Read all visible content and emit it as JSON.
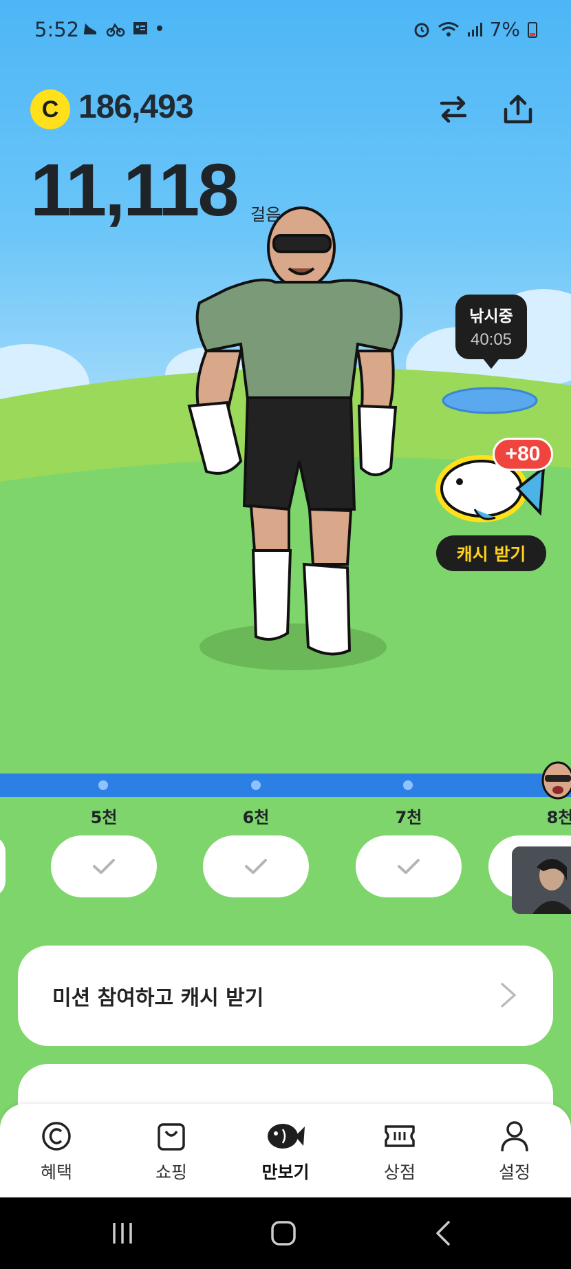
{
  "status_bar": {
    "time": "5:52",
    "battery": "7%"
  },
  "header": {
    "coin_symbol": "C",
    "coin_amount": "186,493"
  },
  "steps": {
    "count": "11,118",
    "unit": "걸음"
  },
  "fishing": {
    "label": "낚시중",
    "timer": "40:05",
    "bonus": "+80",
    "cash_button": "캐시 받기"
  },
  "milestones": [
    {
      "label": "5천",
      "completed": true
    },
    {
      "label": "6천",
      "completed": true
    },
    {
      "label": "7천",
      "completed": true
    },
    {
      "label": "8천",
      "completed": false
    }
  ],
  "mission": {
    "label": "미션 참여하고 캐시 받기"
  },
  "bottom_nav": {
    "items": [
      {
        "label": "혜택",
        "icon": "copyright-circle-icon"
      },
      {
        "label": "쇼핑",
        "icon": "shopping-bag-icon"
      },
      {
        "label": "만보기",
        "icon": "fish-icon",
        "active": true
      },
      {
        "label": "상점",
        "icon": "ticket-icon"
      },
      {
        "label": "설정",
        "icon": "person-icon"
      }
    ]
  },
  "colors": {
    "sky": "#4db6f6",
    "grass": "#7ed56b",
    "progress": "#2c7fe3",
    "coin": "#ffe01b",
    "badge_red": "#f0453e"
  }
}
